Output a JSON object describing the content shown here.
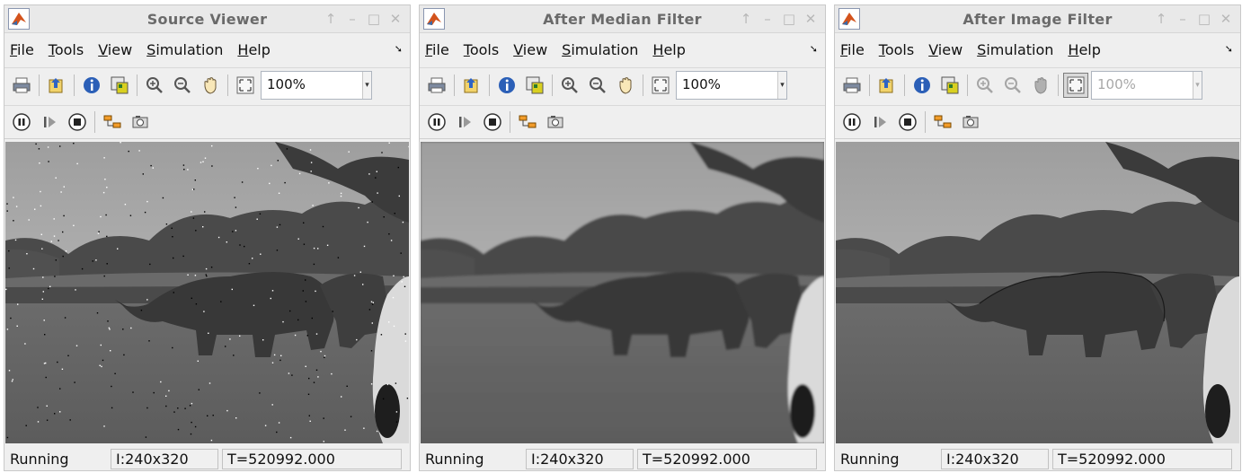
{
  "menu": [
    {
      "label": "File",
      "underline": "F",
      "rest": "ile"
    },
    {
      "label": "Tools",
      "underline": "T",
      "rest": "ools"
    },
    {
      "label": "View",
      "underline": "V",
      "rest": "iew"
    },
    {
      "label": "Simulation",
      "underline": "S",
      "rest": "imulation"
    },
    {
      "label": "Help",
      "underline": "H",
      "rest": "elp"
    }
  ],
  "windows": [
    {
      "title": "Source Viewer",
      "zoom": "100%",
      "status": "Running",
      "size": "I:240x320",
      "time": "T=520992.000",
      "image": "noisy"
    },
    {
      "title": "After Median Filter",
      "zoom": "100%",
      "status": "Running",
      "size": "I:240x320",
      "time": "T=520992.000",
      "image": "blurred"
    },
    {
      "title": "After Image Filter",
      "zoom": "100%",
      "status": "Running",
      "size": "I:240x320",
      "time": "T=520992.000",
      "image": "sharpened"
    }
  ],
  "colors": {
    "titlebar": "#e9e9e9",
    "window_bg": "#efefef",
    "title_text": "#6a6a6a"
  }
}
